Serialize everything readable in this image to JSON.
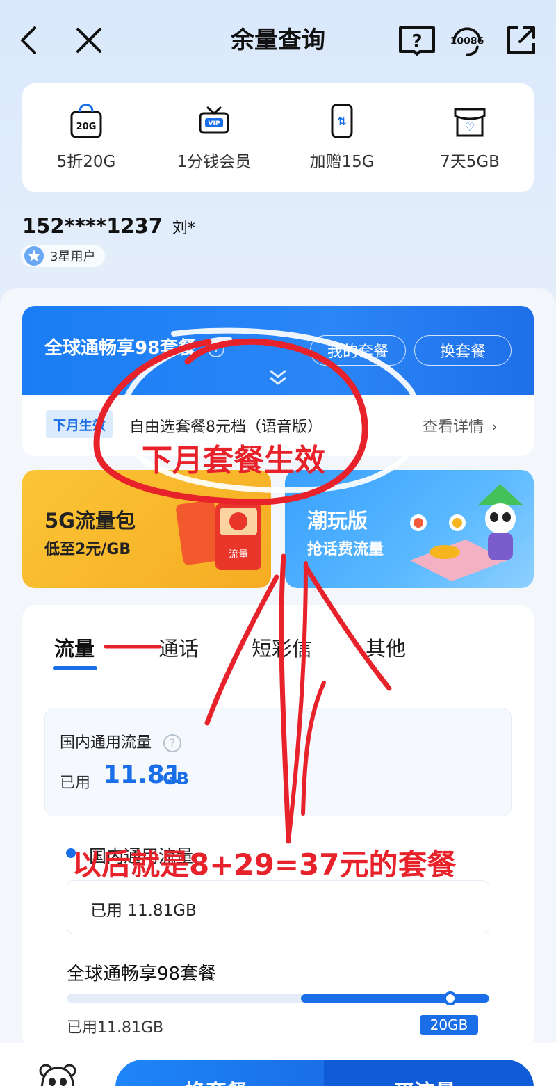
{
  "header": {
    "title": "余量查询",
    "service_number": "10086",
    "help_glyph": "?"
  },
  "quick_actions": [
    {
      "icon": "bag-20g-icon",
      "icon_text": "20G",
      "label": "5折20G"
    },
    {
      "icon": "tv-vip-icon",
      "icon_text": "VIP",
      "label": "1分钱会员"
    },
    {
      "icon": "phone-data-icon",
      "icon_text": "⇅",
      "label": "加赠15G"
    },
    {
      "icon": "gift-box-icon",
      "icon_text": "♡",
      "label": "7天5GB"
    }
  ],
  "user": {
    "phone": "152****1237",
    "name": "刘*",
    "level": "3星用户"
  },
  "plan": {
    "name": "全球通畅享98套餐",
    "my_plan_button": "我的套餐",
    "change_plan_button": "换套餐",
    "next_month_tag": "下月生效",
    "next_month_plan": "自由选套餐8元档（语音版）",
    "details_link": "查看详情"
  },
  "promos": [
    {
      "title": "5G流量包",
      "subtitle": "低至2元/GB",
      "coupon_text": "流量"
    },
    {
      "title": "潮玩版",
      "subtitle": "抢话费流量"
    }
  ],
  "tabs": [
    "流量",
    "通话",
    "短彩信",
    "其他"
  ],
  "usage_summary": {
    "title": "国内通用流量",
    "used_label": "已用",
    "used_value": "11.81",
    "used_unit": "GB"
  },
  "usage_detail": {
    "section_title": "国内通用流量",
    "box_text": "已用 11.81GB",
    "plan_name": "全球通畅享98套餐",
    "used_text": "已用11.81GB",
    "cap": "20GB",
    "used_fraction": 0.59
  },
  "bottom_bar": {
    "left_button": "换套餐",
    "right_button": "买流量"
  },
  "annotations": {
    "note_1": "下月套餐生效",
    "note_2": "以后就是8+29=37元的套餐"
  },
  "colors": {
    "accent": "#1a6fe8",
    "annotation_red": "#e8222b",
    "promo_yellow": "#f6ac22",
    "promo_blue": "#3aa0ff"
  }
}
